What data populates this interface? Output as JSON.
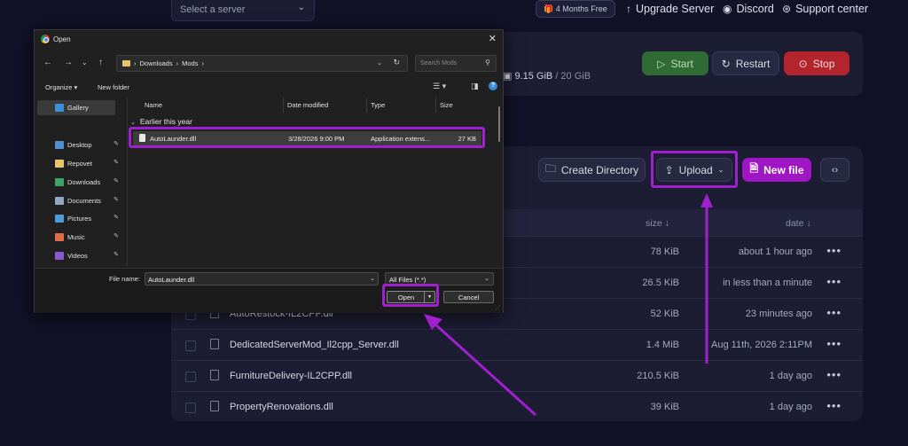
{
  "topbar": {
    "server_select_placeholder": "Select a server",
    "free_badge": "4 Months Free",
    "upgrade_label": "Upgrade Server",
    "discord_label": "Discord",
    "support_label": "Support center"
  },
  "server_card": {
    "disk_used": "9.15 GiB",
    "disk_total": " / 20 GiB",
    "start_label": "Start",
    "restart_label": "Restart",
    "stop_label": "Stop"
  },
  "file_manager": {
    "create_dir_label": "Create Directory",
    "upload_label": "Upload",
    "new_file_label": "New file",
    "columns": {
      "size": "size",
      "date": "date"
    },
    "rows": [
      {
        "name": "",
        "size": "78 KiB",
        "date": "about 1 hour ago"
      },
      {
        "name": "",
        "size": "26.5 KiB",
        "date": "in less than a minute"
      },
      {
        "name": "AutoRestock-IL2CPP.dll",
        "size": "52 KiB",
        "date": "23 minutes ago"
      },
      {
        "name": "DedicatedServerMod_Il2cpp_Server.dll",
        "size": "1.4 MiB",
        "date": "Aug 11th, 2026 2:11PM"
      },
      {
        "name": "FurnitureDelivery-IL2CPP.dll",
        "size": "210.5 KiB",
        "date": "1 day ago"
      },
      {
        "name": "PropertyRenovations.dll",
        "size": "39 KiB",
        "date": "1 day ago"
      }
    ]
  },
  "dialog": {
    "title": "Open",
    "breadcrumb": [
      "Downloads",
      "Mods"
    ],
    "search_placeholder": "Search Mods",
    "organize_label": "Organize",
    "new_folder_label": "New folder",
    "nav_items": [
      {
        "label": "Gallery",
        "pinned": false,
        "color": "#3d8fd6"
      },
      {
        "label": "Desktop",
        "pinned": true,
        "color": "#4f8fd0"
      },
      {
        "label": "Repovet",
        "pinned": true,
        "color": "#e8c46a"
      },
      {
        "label": "Downloads",
        "pinned": true,
        "color": "#3fa46a"
      },
      {
        "label": "Documents",
        "pinned": true,
        "color": "#8fa7c4"
      },
      {
        "label": "Pictures",
        "pinned": true,
        "color": "#4f9ad8"
      },
      {
        "label": "Music",
        "pinned": true,
        "color": "#e06b4a"
      },
      {
        "label": "Videos",
        "pinned": true,
        "color": "#8a5ad0"
      }
    ],
    "columns": {
      "name": "Name",
      "date": "Date modified",
      "type": "Type",
      "size": "Size"
    },
    "group_label": "Earlier this year",
    "files": [
      {
        "name": "AutoLaunder.dll",
        "date": "3/28/2026 9:00 PM",
        "type": "Application extens...",
        "size": "27 KB"
      }
    ],
    "file_name_label": "File name:",
    "file_name_value": "AutoLaunder.dll",
    "file_type_value": "All Files (*.*)",
    "open_label": "Open",
    "cancel_label": "Cancel"
  },
  "colors": {
    "highlight": "#a020d0",
    "accent": "#a116c4",
    "start": "#2f6b33",
    "stop": "#b3242c"
  }
}
